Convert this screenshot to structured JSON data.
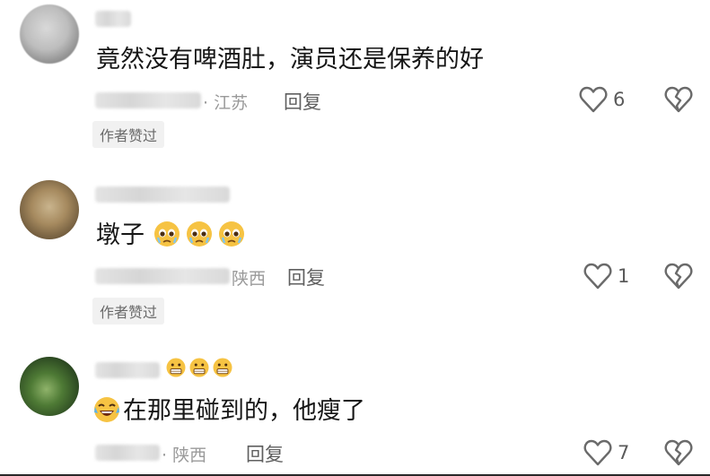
{
  "comments": [
    {
      "text": "竟然没有啤酒肚，演员还是保养的好",
      "location": "· 江苏",
      "reply_label": "回复",
      "likes": "6",
      "author_liked_badge": "作者赞过"
    },
    {
      "text": "墩子",
      "location": "陕西",
      "reply_label": "回复",
      "likes": "1",
      "author_liked_badge": "作者赞过"
    },
    {
      "text": "在那里碰到的，他瘦了",
      "location": "· 陕西",
      "reply_label": "回复",
      "likes": "7"
    }
  ],
  "icons": {
    "like": "heart-outline-icon",
    "dislike": "broken-heart-icon",
    "emoji_pleading": "pleading-face-emoji",
    "emoji_laugh": "laughing-tears-emoji",
    "emoji_grimace": "grimacing-face-emoji"
  },
  "colors": {
    "text": "#161616",
    "meta": "#9a9a9a",
    "badge_bg": "#f1f1f1"
  }
}
